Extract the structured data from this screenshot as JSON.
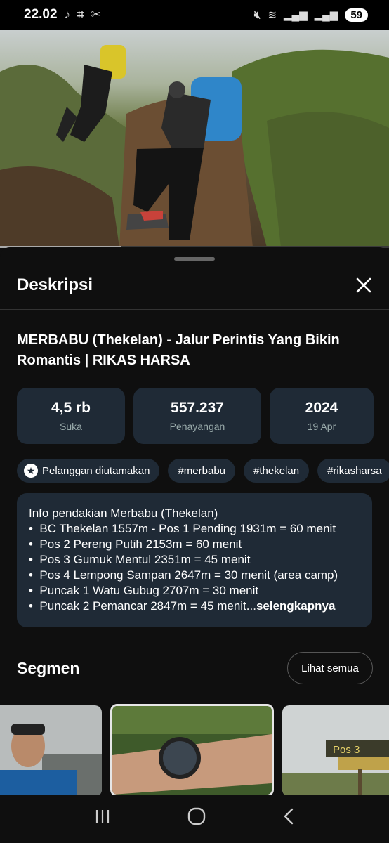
{
  "status_bar": {
    "time": "22.02",
    "battery": "59"
  },
  "video_progress": 0.31,
  "sheet": {
    "title": "Deskripsi",
    "video_title_line1": "MERBABU (Thekelan) -  Jalur Perintis Yang Bikin",
    "video_title_line2": "Romantis | RIKAS HARSA",
    "stats": [
      {
        "value": "4,5 rb",
        "label": "Suka"
      },
      {
        "value": "557.237",
        "label": "Penayangan"
      },
      {
        "value": "2024",
        "label": "19 Apr"
      }
    ],
    "chips": [
      {
        "label": "Pelanggan diutamakan",
        "icon": "star-icon"
      },
      {
        "label": "#merbabu"
      },
      {
        "label": "#thekelan"
      },
      {
        "label": "#rikasharsa"
      }
    ],
    "description": {
      "heading": "Info pendakian Merbabu (Thekelan)",
      "items": [
        "BC Thekelan 1557m - Pos 1 Pending 1931m = 60 menit",
        "Pos 2 Pereng Putih 2153m = 60 menit",
        "Pos 3 Gumuk Mentul 2351m = 45 menit",
        "Pos 4 Lempong Sampan 2647m = 30 menit (area camp)",
        "Puncak 1 Watu Gubug 2707m = 30 menit",
        "Puncak 2 Pemancar 2847m = 45 menit..."
      ],
      "more_label": "selengkapnya"
    },
    "segments": {
      "title": "Segmen",
      "see_all_label": "Lihat semua",
      "thumb3_sign_text": "Pos 3"
    }
  },
  "nav": {
    "recents_icon": "recents-icon",
    "home_icon": "home-icon",
    "back_icon": "back-icon"
  }
}
